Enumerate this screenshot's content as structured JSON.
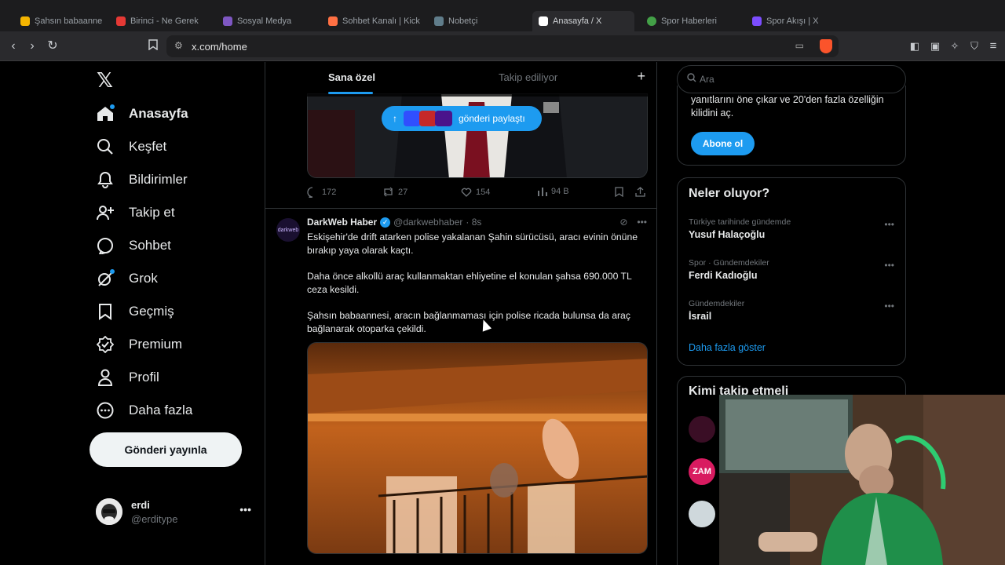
{
  "browser": {
    "tabs": [
      {
        "title": "Şahsın babaannesi, aracın",
        "color": "#f4b400"
      },
      {
        "title": "Birinci - Ne Gerek",
        "color": "#e53935"
      },
      {
        "title": "Sosyal Medya",
        "color": "#7e57c2"
      },
      {
        "title": "Sohbet Kanalı | Kick",
        "color": "#ff7043"
      },
      {
        "title": "Nobetçi",
        "color": "#607d8b"
      },
      {
        "title": "Anasayfa / X",
        "color": "#ffffff"
      },
      {
        "title": "Spor Haberleri",
        "color": "#43a047"
      },
      {
        "title": "Spor Akışı | X",
        "color": "#7c4dff"
      }
    ],
    "url": "x.com/home"
  },
  "nav": {
    "items": [
      {
        "label": "Anasayfa",
        "icon": "home-icon"
      },
      {
        "label": "Keşfet",
        "icon": "search-icon"
      },
      {
        "label": "Bildirimler",
        "icon": "bell-icon"
      },
      {
        "label": "Takip et",
        "icon": "person-plus-icon"
      },
      {
        "label": "Sohbet",
        "icon": "chat-icon"
      },
      {
        "label": "Grok",
        "icon": "grok-icon"
      },
      {
        "label": "Geçmiş",
        "icon": "bookmark-icon"
      },
      {
        "label": "Premium",
        "icon": "premium-icon"
      },
      {
        "label": "Profil",
        "icon": "person-icon"
      },
      {
        "label": "Daha fazla",
        "icon": "more-circle-icon"
      }
    ],
    "post_button": "Gönderi yayınla",
    "account": {
      "name": "erdi",
      "handle": "@erditype"
    }
  },
  "feed": {
    "tab_for_you": "Sana özel",
    "tab_following": "Takip ediliyor",
    "share_pill": "gönderi paylaştı",
    "post1_stats": {
      "replies": "172",
      "reposts": "27",
      "likes": "154",
      "views": "94 B"
    },
    "post2": {
      "name": "DarkWeb Haber",
      "handle": "@darkwebhaber",
      "time": "· 8s",
      "avatar_text": "darkweb",
      "paragraphs": [
        "Eskişehir'de drift atarken polise yakalanan Şahin sürücüsü, aracı evinin önüne bırakıp yaya olarak kaçtı.",
        "Daha önce alkollü araç kullanmaktan ehliyetine el konulan şahsa 690.000 TL ceza kesildi.",
        "Şahsın babaannesi, aracın bağlanmaması için polise ricada bulunsa da araç bağlanarak otoparka çekildi."
      ]
    }
  },
  "right": {
    "search_placeholder": "Ara",
    "premium_text": "yanıtlarını öne çıkar ve 20'den fazla özelliğin kilidini aç.",
    "subscribe": "Abone ol",
    "trends_title": "Neler oluyor?",
    "trends": [
      {
        "meta": "Türkiye tarihinde gündemde",
        "name": "Yusuf Halaçoğlu"
      },
      {
        "meta": "Spor · Gündemdekiler",
        "name": "Ferdi Kadıoğlu"
      },
      {
        "meta": "Gündemdekiler",
        "name": "İsrail"
      }
    ],
    "show_more": "Daha fazla göster",
    "who_to_follow": "Kimi takip etmeli",
    "wtf_avatars": [
      {
        "label": "",
        "color": "#3a0e25"
      },
      {
        "label": "ZAM",
        "color": "#d81b60"
      },
      {
        "label": "",
        "color": "#cfd8dc"
      }
    ]
  }
}
